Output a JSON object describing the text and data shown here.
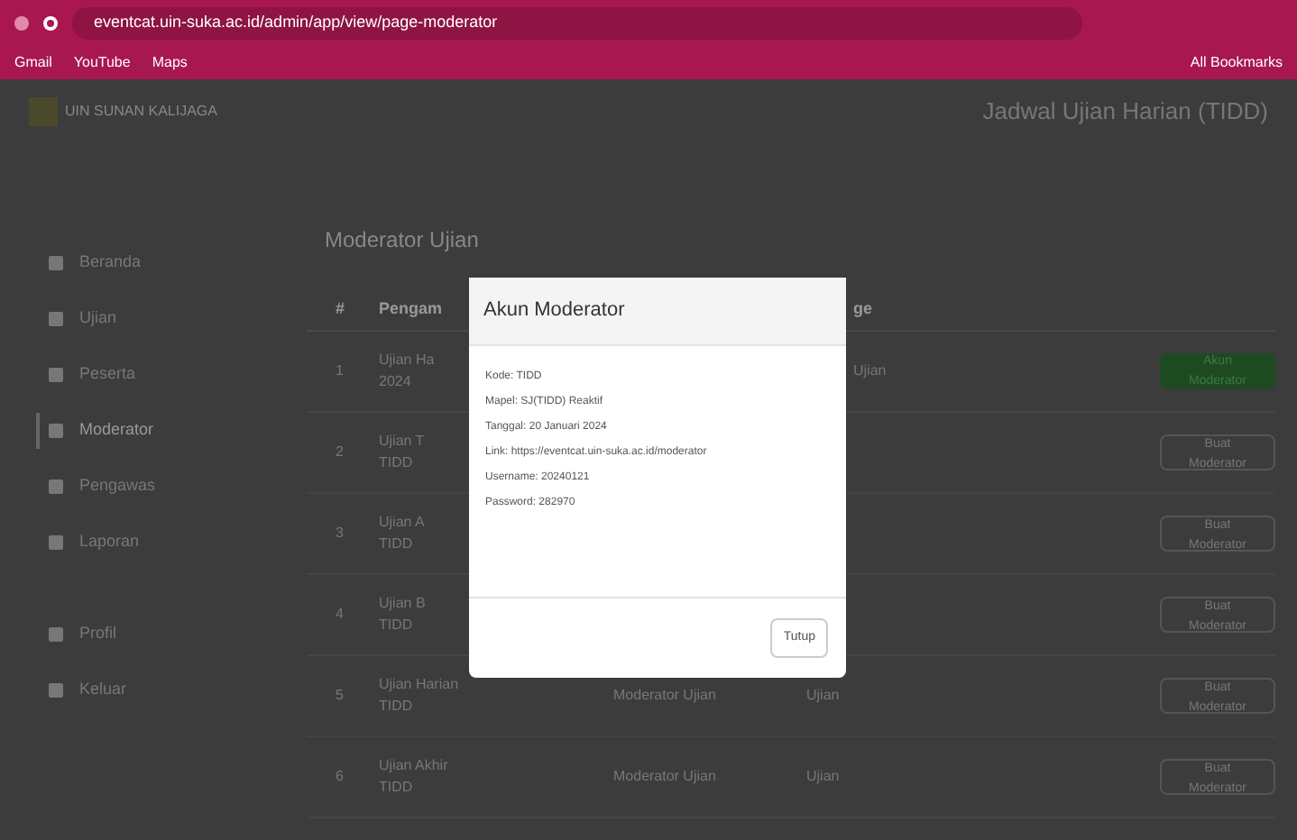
{
  "browser": {
    "url": "eventcat.uin-suka.ac.id/admin/app/view/page-moderator",
    "bookmarks": [
      "Gmail",
      "YouTube",
      "Maps"
    ],
    "all_bookmarks": "All Bookmarks"
  },
  "header": {
    "logo_text": "UIN SUNAN KALIJAGA",
    "title": "Jadwal Ujian Harian (TIDD)"
  },
  "sidebar": {
    "items": [
      {
        "label": "Beranda",
        "selected": false
      },
      {
        "label": "Ujian",
        "selected": false
      },
      {
        "label": "Peserta",
        "selected": false
      },
      {
        "label": "Moderator",
        "selected": true
      },
      {
        "label": "Pengawas",
        "selected": false
      },
      {
        "label": "Laporan",
        "selected": false
      },
      {
        "label": "Profil",
        "selected": false
      },
      {
        "label": "Keluar",
        "selected": false
      }
    ]
  },
  "page_title": "Moderator Ujian",
  "table": {
    "columns": [
      "#",
      "Pengam",
      "ge"
    ],
    "rows": [
      {
        "number": "1",
        "cell_1": "Ujian Ha",
        "cell_1b": "2024",
        "cell_2": "",
        "cell_3": "Ujian",
        "action": "Akun Moderator",
        "kind": "account"
      },
      {
        "number": "2",
        "cell_1": "Ujian T",
        "cell_1b": "TIDD",
        "cell_2": "",
        "cell_3": "",
        "action": "Buat Moderator",
        "kind": "create"
      },
      {
        "number": "3",
        "cell_1": "Ujian A",
        "cell_1b": "TIDD",
        "cell_2": "",
        "cell_3": "",
        "action": "Buat Moderator",
        "kind": "create"
      },
      {
        "number": "4",
        "cell_1": "Ujian B",
        "cell_1b": "TIDD",
        "cell_2": "",
        "cell_3": "",
        "action": "Buat Moderator",
        "kind": "create"
      },
      {
        "number": "5",
        "cell_1": "Ujian Harian",
        "cell_1b": "TIDD",
        "cell_2": "Moderator Ujian",
        "cell_3": "Ujian",
        "action": "Buat Moderator",
        "kind": "create"
      },
      {
        "number": "6",
        "cell_1": "Ujian Akhir",
        "cell_1b": "TIDD",
        "cell_2": "Moderator Ujian",
        "cell_3": "Ujian",
        "action": "Buat Moderator",
        "kind": "create"
      }
    ]
  },
  "modal": {
    "title": "Akun Moderator",
    "lines": [
      "Kode: TIDD",
      "Mapel: SJ(TIDD) Reaktif",
      "Tanggal: 20 Januari 2024",
      "Link: https://eventcat.uin-suka.ac.id/moderator",
      "Username: 20240121",
      "Password: 282970"
    ],
    "close_button": "Tutup"
  }
}
